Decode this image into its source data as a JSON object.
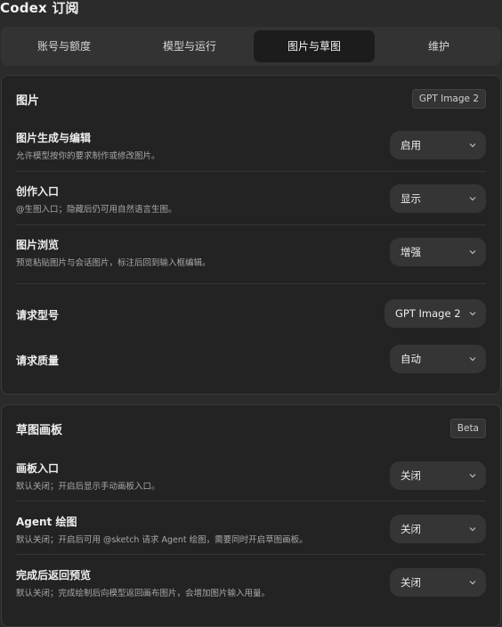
{
  "window": {
    "title": "Codex 订阅"
  },
  "tabs": [
    {
      "label": "账号与额度"
    },
    {
      "label": "模型与运行"
    },
    {
      "label": "图片与草图"
    },
    {
      "label": "维护"
    }
  ],
  "images_section": {
    "title": "图片",
    "badge": "GPT Image 2",
    "rows": [
      {
        "title": "图片生成与编辑",
        "desc": "允许模型按你的要求制作或修改图片。",
        "value": "启用"
      },
      {
        "title": "创作入口",
        "desc": "@生图入口；隐藏后仍可用自然语言生图。",
        "value": "显示"
      },
      {
        "title": "图片浏览",
        "desc": "预览粘贴图片与会话图片，标注后回到输入框编辑。",
        "value": "增强"
      },
      {
        "title": "请求型号",
        "value": "GPT Image 2"
      },
      {
        "title": "请求质量",
        "value": "自动"
      }
    ]
  },
  "sketch_section": {
    "title": "草图画板",
    "badge": "Beta",
    "rows": [
      {
        "title": "画板入口",
        "desc": "默认关闭；开启后显示手动画板入口。",
        "value": "关闭"
      },
      {
        "title": "Agent 绘图",
        "desc": "默认关闭；开启后可用 @sketch 请求 Agent 绘图，需要同时开启草图画板。",
        "value": "关闭"
      },
      {
        "title": "完成后返回预览",
        "desc": "默认关闭；完成绘制后向模型返回画布图片，会增加图片输入用量。",
        "value": "关闭"
      }
    ]
  }
}
